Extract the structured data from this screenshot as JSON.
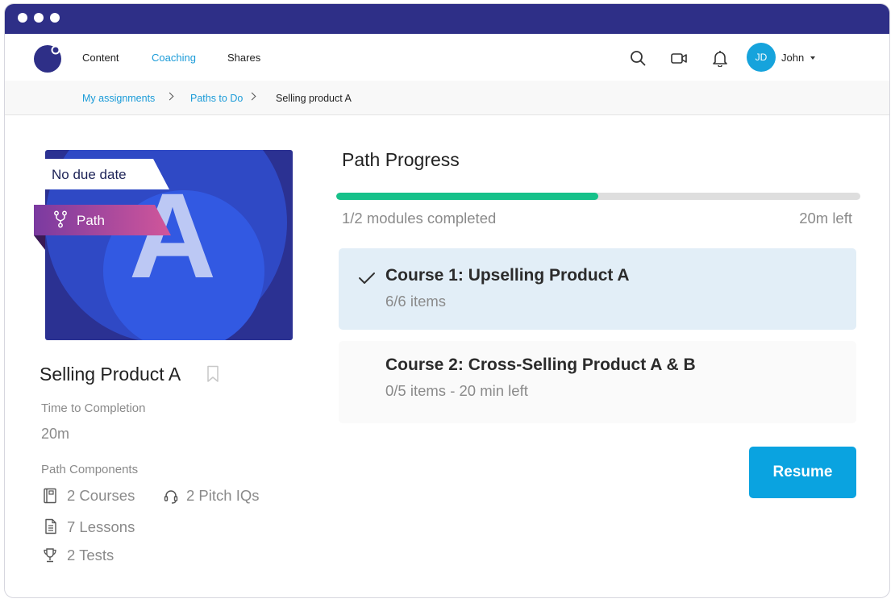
{
  "window": {
    "accent": "#2e2f87"
  },
  "nav": {
    "links": [
      "Content",
      "Coaching",
      "Shares"
    ],
    "active": "Coaching",
    "icons": [
      "search-icon",
      "video-icon",
      "bell-icon"
    ],
    "user": {
      "initials": "JD",
      "name": "John"
    }
  },
  "breadcrumb": {
    "items": [
      "My assignments",
      "Paths to Do"
    ],
    "current": "Selling product A"
  },
  "path": {
    "thumbnail_letter": "A",
    "due_label": "No due date",
    "type_label": "Path",
    "title": "Selling Product A",
    "time_label": "Time to Completion",
    "time_value": "20m",
    "components_label": "Path Components",
    "components": {
      "courses": "2 Courses",
      "pitch": "2 Pitch IQs",
      "lessons": "7 Lessons",
      "tests": "2 Tests"
    }
  },
  "progress": {
    "title": "Path Progress",
    "fraction": 0.5,
    "completed_text": "1/2 modules completed",
    "time_left": "20m left",
    "bar_color": "#16c18a"
  },
  "courses": [
    {
      "title": "Course 1: Upselling Product A",
      "subtitle": "6/6 items",
      "completed": true
    },
    {
      "title": "Course 2: Cross-Selling Product A & B",
      "subtitle": "0/5 items - 20 min left",
      "completed": false
    }
  ],
  "actions": {
    "resume_label": "Resume",
    "button_color": "#0aa3e0"
  }
}
